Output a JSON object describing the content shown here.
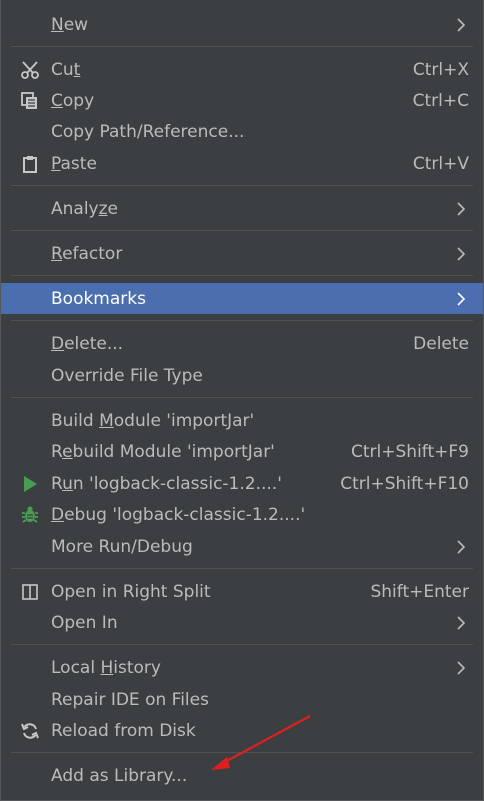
{
  "menu": {
    "items": [
      {
        "id": "new",
        "pre": "",
        "u": "N",
        "post": "ew",
        "shortcut": "",
        "arrow": true,
        "icon": ""
      },
      {
        "id": "cut",
        "pre": "Cu",
        "u": "t",
        "post": "",
        "shortcut": "Ctrl+X",
        "arrow": false,
        "icon": "scissors-icon"
      },
      {
        "id": "copy",
        "pre": "",
        "u": "C",
        "post": "opy",
        "shortcut": "Ctrl+C",
        "arrow": false,
        "icon": "copy-icon"
      },
      {
        "id": "copy-path",
        "pre": "Copy Path/Reference...",
        "u": "",
        "post": "",
        "shortcut": "",
        "arrow": false,
        "icon": ""
      },
      {
        "id": "paste",
        "pre": "",
        "u": "P",
        "post": "aste",
        "shortcut": "Ctrl+V",
        "arrow": false,
        "icon": "clipboard-icon"
      },
      {
        "id": "analyze",
        "pre": "Analy",
        "u": "z",
        "post": "e",
        "shortcut": "",
        "arrow": true,
        "icon": ""
      },
      {
        "id": "refactor",
        "pre": "",
        "u": "R",
        "post": "efactor",
        "shortcut": "",
        "arrow": true,
        "icon": ""
      },
      {
        "id": "bookmarks",
        "pre": "Bookmarks",
        "u": "",
        "post": "",
        "shortcut": "",
        "arrow": true,
        "icon": "",
        "selected": true
      },
      {
        "id": "delete",
        "pre": "",
        "u": "D",
        "post": "elete...",
        "shortcut": "Delete",
        "arrow": false,
        "icon": ""
      },
      {
        "id": "override-file-type",
        "pre": "Override File Type",
        "u": "",
        "post": "",
        "shortcut": "",
        "arrow": false,
        "icon": ""
      },
      {
        "id": "build-module",
        "pre": "Build ",
        "u": "M",
        "post": "odule 'importJar'",
        "shortcut": "",
        "arrow": false,
        "icon": ""
      },
      {
        "id": "rebuild-module",
        "pre": "R",
        "u": "e",
        "post": "build Module 'importJar'",
        "shortcut": "Ctrl+Shift+F9",
        "arrow": false,
        "icon": ""
      },
      {
        "id": "run",
        "pre": "R",
        "u": "u",
        "post": "n 'logback-classic-1.2....'",
        "shortcut": "Ctrl+Shift+F10",
        "arrow": false,
        "icon": "run-icon"
      },
      {
        "id": "debug",
        "pre": "",
        "u": "D",
        "post": "ebug 'logback-classic-1.2....'",
        "shortcut": "",
        "arrow": false,
        "icon": "bug-icon"
      },
      {
        "id": "more-run-debug",
        "pre": "More Run/Debug",
        "u": "",
        "post": "",
        "shortcut": "",
        "arrow": true,
        "icon": ""
      },
      {
        "id": "open-right-split",
        "pre": "Open in Right Split",
        "u": "",
        "post": "",
        "shortcut": "Shift+Enter",
        "arrow": false,
        "icon": "split-icon"
      },
      {
        "id": "open-in",
        "pre": "Open In",
        "u": "",
        "post": "",
        "shortcut": "",
        "arrow": true,
        "icon": ""
      },
      {
        "id": "local-history",
        "pre": "Local ",
        "u": "H",
        "post": "istory",
        "shortcut": "",
        "arrow": true,
        "icon": ""
      },
      {
        "id": "repair-ide",
        "pre": "Repair IDE on Files",
        "u": "",
        "post": "",
        "shortcut": "",
        "arrow": false,
        "icon": ""
      },
      {
        "id": "reload-from-disk",
        "pre": "Reload from Disk",
        "u": "",
        "post": "",
        "shortcut": "",
        "arrow": false,
        "icon": "reload-icon"
      },
      {
        "id": "add-as-library",
        "pre": "Add as Library...",
        "u": "",
        "post": "",
        "shortcut": "",
        "arrow": false,
        "icon": ""
      }
    ]
  },
  "colors": {
    "background": "#3c3f41",
    "selection": "#4b6eaf",
    "text": "#bbbbbb",
    "separator": "#515151",
    "run_green": "#499c54",
    "annotation_arrow": "#e02020"
  }
}
